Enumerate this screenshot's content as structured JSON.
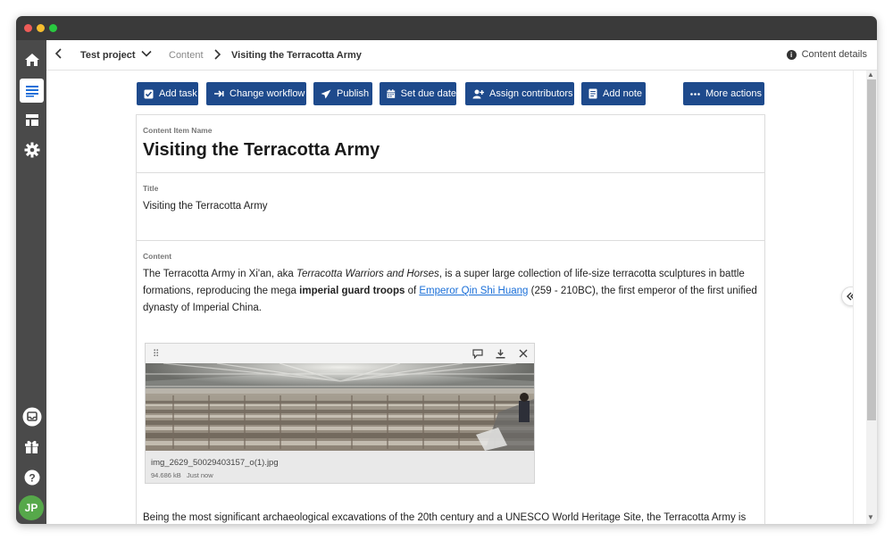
{
  "breadcrumb": {
    "project": "Test project",
    "section": "Content",
    "current": "Visiting the Terracotta Army"
  },
  "header": {
    "details_label": "Content details"
  },
  "user": {
    "initials": "JP"
  },
  "toolbar": {
    "add_task": "Add task",
    "change_workflow": "Change workflow",
    "publish": "Publish",
    "set_due_date": "Set due date",
    "assign_contributors": "Assign contributors",
    "add_note": "Add note",
    "more_actions": "More actions"
  },
  "fields": {
    "name_label": "Content Item Name",
    "name_value": "Visiting the Terracotta Army",
    "title_label": "Title",
    "title_value": "Visiting the Terracotta Army",
    "content_label": "Content"
  },
  "content": {
    "p1_a": "The Terracotta Army in Xi'an, aka ",
    "p1_italic": "Terracotta Warriors and Horses",
    "p1_b": ", is a super large collection of life-size terracotta sculptures in battle formations, reproducing the mega ",
    "p1_bold": "imperial guard troops",
    "p1_c": " of ",
    "p1_link": "Emperor Qin Shi Huang",
    "p1_d": " (259 - 210BC), the first emperor of the first unified dynasty of Imperial China.",
    "p2": "Being the most significant archaeological excavations of the 20th century and a UNESCO World Heritage Site, the Terracotta Army is no"
  },
  "image": {
    "filename": "img_2629_50029403157_o(1).jpg",
    "size": "94.686 kB",
    "time": "Just now"
  },
  "colors": {
    "button_bg": "#1e4a8c",
    "sidebar_bg": "#4a4a4a",
    "link": "#1a6fd8",
    "avatar": "#56a84a"
  }
}
